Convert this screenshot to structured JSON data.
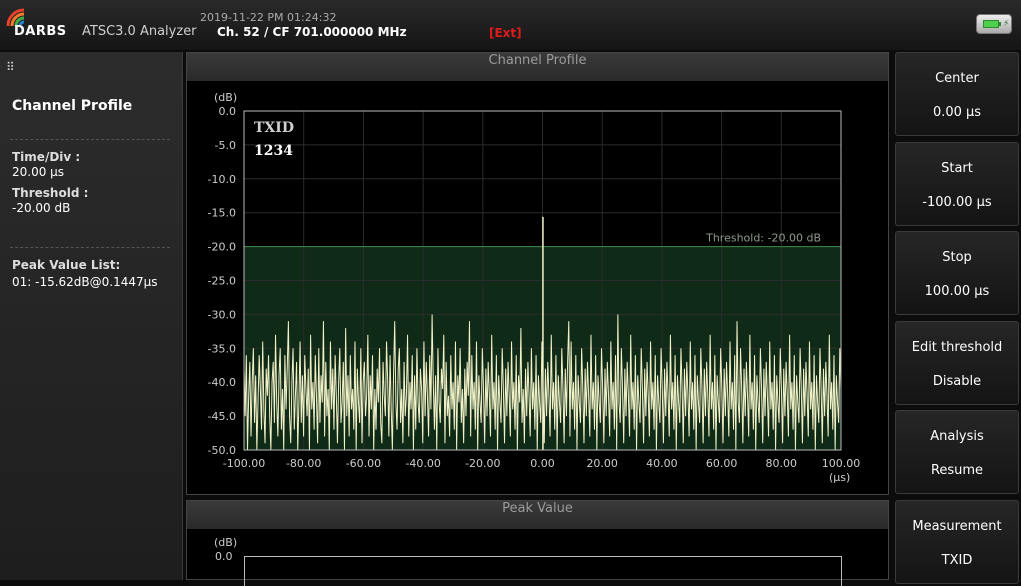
{
  "header": {
    "brand": "DARBS",
    "app_name": "ATSC3.0 Analyzer",
    "datetime": "2019-11-22 PM 01:24:32",
    "channel": "Ch. 52 / CF 701.000000 MHz",
    "ext": "[Ext]",
    "battery_icon": "battery-charging-icon"
  },
  "left_panel": {
    "title": "Channel Profile",
    "time_div_label": "Time/Div :",
    "time_div_value": "20.00 µs",
    "threshold_label": "Threshold :",
    "threshold_value": "-20.00 dB",
    "peak_list_label": "Peak Value List:",
    "peak_entries": [
      "01: -15.62dB@0.1447µs"
    ]
  },
  "channel_profile": {
    "title": "Channel Profile",
    "y_unit": "(dB)",
    "x_unit": "(µs)",
    "txid_label": "TXID",
    "txid_value": "1234",
    "threshold_text": "Threshold: -20.00 dB",
    "colors": {
      "trace": "#f2f2c8",
      "threshold_fill": "#0f2a16",
      "threshold_line": "#3c8a45",
      "grid": "#2c2c2c"
    }
  },
  "peak_value": {
    "title": "Peak Value",
    "y_unit": "(dB)",
    "y_top_label": "0.0"
  },
  "chart_data": {
    "type": "line",
    "title": "Channel Profile",
    "xlabel": "(µs)",
    "ylabel": "(dB)",
    "xlim": [
      -100,
      100
    ],
    "ylim": [
      -50,
      0
    ],
    "x_ticks": [
      "-100.00",
      "-80.00",
      "-60.00",
      "-40.00",
      "-20.00",
      "0.00",
      "20.00",
      "40.00",
      "60.00",
      "80.00",
      "100.00"
    ],
    "y_ticks": [
      "0.0",
      "-5.0",
      "-10.0",
      "-15.0",
      "-20.0",
      "-25.0",
      "-30.0",
      "-35.0",
      "-40.0",
      "-45.0",
      "-50.0"
    ],
    "threshold": -20.0,
    "peak": {
      "x": 0.1447,
      "y": -15.62
    },
    "grid": true,
    "series": [
      {
        "noise_floor_range": [
          -50,
          -30
        ],
        "values": [
          -38,
          -45,
          -36,
          -50,
          -42,
          -37,
          -48,
          -40,
          -35,
          -46,
          -39,
          -50,
          -43,
          -36,
          -41,
          -47,
          -34,
          -44,
          -49,
          -38,
          -42,
          -36,
          -45,
          -50,
          -40,
          -37,
          -46,
          -33,
          -43,
          -48,
          -39,
          -35,
          -47,
          -41,
          -50,
          -36,
          -44,
          -38,
          -31,
          -45,
          -49,
          -40,
          -35,
          -47,
          -42,
          -37,
          -50,
          -43,
          -34,
          -46,
          -39,
          -48,
          -36,
          -41,
          -45,
          -38,
          -50,
          -33,
          -44,
          -40,
          -47,
          -36,
          -42,
          -49,
          -35,
          -46,
          -39,
          -43,
          -31,
          -48,
          -37,
          -45,
          -41,
          -50,
          -34,
          -44,
          -38,
          -47,
          -36,
          -42,
          -49,
          -40,
          -35,
          -46,
          -43,
          -37,
          -50,
          -32,
          -45,
          -39,
          -48,
          -36,
          -44,
          -41,
          -47,
          -34,
          -50,
          -38,
          -43,
          -46,
          -35,
          -49,
          -40,
          -37,
          -45,
          -42,
          -33,
          -48,
          -39,
          -44,
          -36,
          -50,
          -41,
          -47,
          -38,
          -43,
          -35,
          -46,
          -49,
          -37,
          -42,
          -45,
          -34,
          -40,
          -48,
          -36,
          -44,
          -50,
          -39,
          -31,
          -43,
          -47,
          -38,
          -35,
          -46,
          -41,
          -49,
          -37,
          -45,
          -42,
          -33,
          -48,
          -40,
          -44,
          -36,
          -50,
          -39,
          -47,
          -35,
          -43,
          -46,
          -38,
          -41,
          -49,
          -34,
          -45,
          -37,
          -42,
          -48,
          -36,
          -44,
          -30,
          -40,
          -47,
          -39,
          -50,
          -35,
          -43,
          -46,
          -38,
          -41,
          -33,
          -49,
          -37,
          -45,
          -42,
          -48,
          -36,
          -44,
          -40,
          -47,
          -34,
          -50,
          -39,
          -43,
          -35,
          -46,
          -41,
          -49,
          -38,
          -45,
          -37,
          -42,
          -31,
          -48,
          -36,
          -44,
          -40,
          -47,
          -34,
          -50,
          -39,
          -43,
          -46,
          -35,
          -41,
          -49,
          -38,
          -45,
          -37,
          -42,
          -48,
          -33,
          -44,
          -40,
          -47,
          -36,
          -50,
          -39,
          -43,
          -46,
          -35,
          -41,
          -49,
          -38,
          -45,
          -37,
          -42,
          -48,
          -34,
          -44,
          -40,
          -47,
          -36,
          -50,
          -39,
          -43,
          -32,
          -46,
          -41,
          -49,
          -38,
          -45,
          -37,
          -42,
          -48,
          -35,
          -44,
          -40,
          -47,
          -36,
          -50,
          -39,
          -43,
          -46,
          -34,
          -41,
          -49,
          -38,
          -45,
          -37,
          -42,
          -48,
          -33,
          -44,
          -40,
          -47,
          -36,
          -50,
          -39,
          -43,
          -46,
          -35,
          -41,
          -49,
          -38,
          -45,
          -37,
          -31,
          -48,
          -34,
          -44,
          -40,
          -47,
          -36,
          -50,
          -39,
          -43,
          -46,
          -35,
          -41,
          -49,
          -38,
          -45,
          -37,
          -42,
          -48,
          -33,
          -44,
          -40,
          -47,
          -36,
          -50,
          -39,
          -43,
          -46,
          -35,
          -41,
          -49,
          -38,
          -45,
          -37,
          -42,
          -48,
          -34,
          -44,
          -40,
          -47,
          -36,
          -50,
          -30,
          -43,
          -46,
          -35,
          -41,
          -49,
          -38,
          -45,
          -37,
          -42,
          -48,
          -33,
          -44,
          -40,
          -47,
          -36,
          -50,
          -39,
          -43,
          -46,
          -35,
          -41,
          -49,
          -38,
          -45,
          -37,
          -42,
          -48,
          -34,
          -44,
          -40,
          -47,
          -36,
          -50,
          -39,
          -43,
          -46,
          -35,
          -41,
          -49,
          -38,
          -45,
          -37,
          -42,
          -48,
          -33,
          -44,
          -40,
          -47,
          -36,
          -50,
          -39,
          -43,
          -46,
          -35,
          -41,
          -49,
          -38,
          -45,
          -37,
          -42,
          -48,
          -34,
          -44,
          -40,
          -47,
          -36,
          -50,
          -39,
          -43,
          -46,
          -35,
          -41,
          -49,
          -38,
          -45,
          -37,
          -42,
          -48,
          -33,
          -44,
          -40,
          -47,
          -36,
          -50,
          -39,
          -43,
          -46,
          -35,
          -41,
          -49,
          -38,
          -45,
          -37,
          -42,
          -48,
          -34,
          -44,
          -40,
          -47,
          -36,
          -50,
          -31,
          -43,
          -46,
          -35,
          -41,
          -49,
          -38,
          -45,
          -37,
          -42,
          -48,
          -33,
          -44,
          -40,
          -47,
          -36,
          -50,
          -39,
          -43,
          -46,
          -35,
          -41,
          -49,
          -38,
          -45,
          -37,
          -42,
          -48,
          -34,
          -44,
          -40,
          -47,
          -36,
          -50,
          -39,
          -43,
          -46,
          -35,
          -41,
          -49,
          -38,
          -45,
          -37,
          -42,
          -48,
          -33,
          -44,
          -40,
          -47,
          -36,
          -50,
          -39,
          -43,
          -46,
          -35,
          -41,
          -49,
          -38,
          -45,
          -37,
          -42,
          -48,
          -34,
          -44,
          -40,
          -47,
          -36,
          -50,
          -39,
          -43,
          -46,
          -35,
          -41,
          -49,
          -38,
          -45,
          -37,
          -42,
          -48,
          -33,
          -44,
          -40,
          -47,
          -36,
          -50,
          -39,
          -43,
          -46,
          -35,
          -41
        ]
      }
    ]
  },
  "soft_keys": [
    {
      "title": "Center",
      "value": "0.00 µs"
    },
    {
      "title": "Start",
      "value": "-100.00 µs"
    },
    {
      "title": "Stop",
      "value": "100.00 µs"
    },
    {
      "title": "Edit threshold",
      "value": "Disable"
    },
    {
      "title": "Analysis",
      "value": "Resume"
    },
    {
      "title": "Measurement",
      "value": "TXID"
    }
  ]
}
